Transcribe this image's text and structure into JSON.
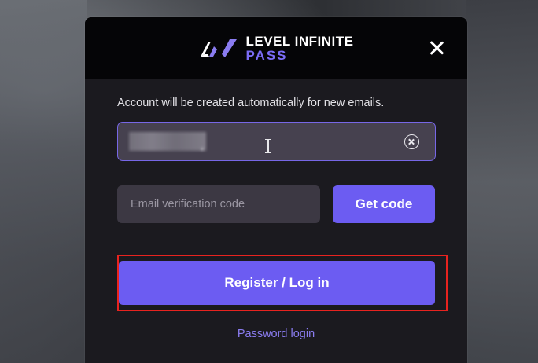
{
  "background": {
    "description_color": "#3b3e44"
  },
  "header": {
    "logo_line1": "LEVEL INFINITE",
    "logo_line2": "PASS",
    "brand_color": "#7b6cf6",
    "close_icon": "close-icon"
  },
  "form": {
    "hint": "Account will be created automatically for new emails.",
    "email_value": "",
    "clear_icon": "clear-circle-icon",
    "code_placeholder": "Email verification code",
    "get_code_label": "Get code",
    "register_label": "Register / Log in",
    "password_login_label": "Password login",
    "accent_color": "#6c5cf2",
    "highlight_color": "#e8231f"
  }
}
